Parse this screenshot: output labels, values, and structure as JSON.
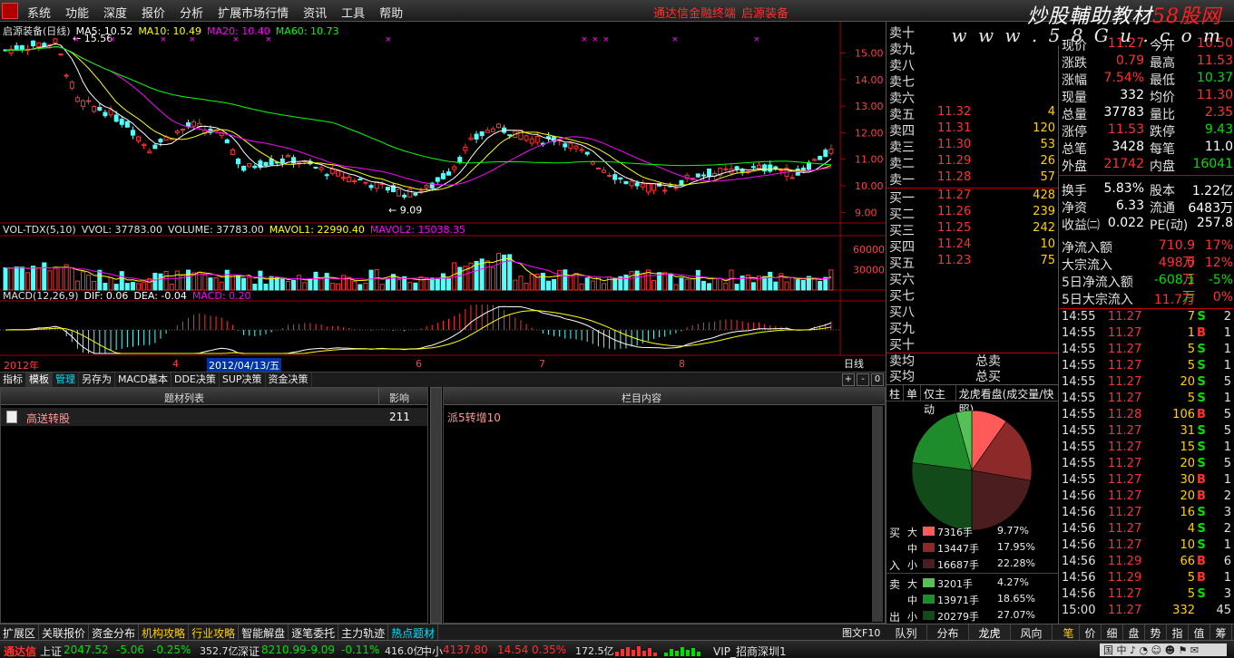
{
  "menubar": {
    "items": [
      "系统",
      "功能",
      "深度",
      "报价",
      "分析",
      "扩展市场行情",
      "资讯",
      "工具",
      "帮助"
    ],
    "center_link_1": "通达信金融终端",
    "center_link_2": "启源装备",
    "brand_main": "炒股輔助教材",
    "brand_domain": "58股网",
    "brand_url": "w w w . 5 8 G u . c o m"
  },
  "chart": {
    "legend_main": {
      "title": "启源装备(日线)",
      "ma5": "MA5: 10.52",
      "ma10": "MA10: 10.49",
      "ma20": "MA20: 10.40",
      "ma60": "MA60: 10.73"
    },
    "legend_vol": {
      "name": "VOL-TDX(5,10)",
      "vvol": "VVOL: 37783.00",
      "volume": "VOLUME: 37783.00",
      "mavol1": "MAVOL1: 22990.40",
      "mavol2": "MAVOL2: 15038.35"
    },
    "legend_macd": {
      "name": "MACD(12,26,9)",
      "dif": "DIF: 0.06",
      "dea": "DEA: -0.04",
      "macd": "MACD: 0.20"
    },
    "price_ticks": [
      "15.00",
      "14.00",
      "13.00",
      "12.00",
      "11.00",
      "10.00",
      "9.00"
    ],
    "vol_ticks": [
      "60000",
      "30000"
    ],
    "high_mark": "15.56",
    "low_mark": "9.09",
    "date_axis": [
      "2012年",
      "4",
      "2012/04/13/五",
      "6",
      "7",
      "8"
    ],
    "period": "日线",
    "colors": {
      "up": "#ff3232",
      "down": "#54fcfc",
      "ma5": "#ffffff",
      "ma10": "#ffff00",
      "ma20": "#ff00ff",
      "ma60": "#00ff00"
    }
  },
  "indicator_tabs": [
    "指标",
    "模板",
    "管理",
    "另存为",
    "MACD基本",
    "DDE决策",
    "SUP决策",
    "资金决策"
  ],
  "indicator_ctl": {
    "plus": "+",
    "minus": "-",
    "zero": "0"
  },
  "topic_pane": {
    "col_list": "题材列表",
    "col_impact": "影响",
    "rows": [
      {
        "name": "高送转股",
        "impact": "211"
      }
    ]
  },
  "content_pane": {
    "title": "栏目内容",
    "text": "派5转增10"
  },
  "orderbook": {
    "sell": [
      {
        "label": "卖十",
        "price": "",
        "vol": ""
      },
      {
        "label": "卖九",
        "price": "",
        "vol": ""
      },
      {
        "label": "卖八",
        "price": "",
        "vol": ""
      },
      {
        "label": "卖七",
        "price": "",
        "vol": ""
      },
      {
        "label": "卖六",
        "price": "",
        "vol": ""
      },
      {
        "label": "卖五",
        "price": "11.32",
        "vol": "4"
      },
      {
        "label": "卖四",
        "price": "11.31",
        "vol": "120"
      },
      {
        "label": "卖三",
        "price": "11.30",
        "vol": "53"
      },
      {
        "label": "卖二",
        "price": "11.29",
        "vol": "26"
      },
      {
        "label": "卖一",
        "price": "11.28",
        "vol": "57"
      }
    ],
    "buy": [
      {
        "label": "买一",
        "price": "11.27",
        "vol": "428"
      },
      {
        "label": "买二",
        "price": "11.26",
        "vol": "239"
      },
      {
        "label": "买三",
        "price": "11.25",
        "vol": "242"
      },
      {
        "label": "买四",
        "price": "11.24",
        "vol": "10"
      },
      {
        "label": "买五",
        "price": "11.23",
        "vol": "75"
      },
      {
        "label": "买六",
        "price": "",
        "vol": ""
      },
      {
        "label": "买七",
        "price": "",
        "vol": ""
      },
      {
        "label": "买八",
        "price": "",
        "vol": ""
      },
      {
        "label": "买九",
        "price": "",
        "vol": ""
      },
      {
        "label": "买十",
        "price": "",
        "vol": ""
      }
    ],
    "avg_sell_label": "卖均",
    "avg_buy_label": "买均",
    "total_sell_label": "总卖",
    "total_buy_label": "总买"
  },
  "quote": {
    "rows": [
      {
        "l1": "现价",
        "v1": "11.27",
        "c1": "red",
        "l2": "今开",
        "v2": "10.50",
        "c2": "red"
      },
      {
        "l1": "涨跌",
        "v1": "0.79",
        "c1": "red",
        "l2": "最高",
        "v2": "11.53",
        "c2": "red"
      },
      {
        "l1": "涨幅",
        "v1": "7.54%",
        "c1": "red",
        "l2": "最低",
        "v2": "10.37",
        "c2": "green"
      },
      {
        "l1": "现量",
        "v1": "332",
        "c1": "white",
        "l2": "均价",
        "v2": "11.30",
        "c2": "red"
      },
      {
        "l1": "总量",
        "v1": "37783",
        "c1": "white",
        "l2": "量比",
        "v2": "2.35",
        "c2": "red"
      },
      {
        "l1": "涨停",
        "v1": "11.53",
        "c1": "red",
        "l2": "跌停",
        "v2": "9.43",
        "c2": "green"
      },
      {
        "l1": "总笔",
        "v1": "3428",
        "c1": "white",
        "l2": "每笔",
        "v2": "11.0",
        "c2": "white"
      },
      {
        "l1": "外盘",
        "v1": "21742",
        "c1": "red",
        "l2": "内盘",
        "v2": "16041",
        "c2": "green"
      },
      {
        "l1": "换手",
        "v1": "5.83%",
        "c1": "white",
        "l2": "股本",
        "v2": "1.22亿",
        "c2": "white"
      },
      {
        "l1": "净资",
        "v1": "6.33",
        "c1": "white",
        "l2": "流通",
        "v2": "6483万",
        "c2": "white"
      },
      {
        "l1": "收益㈡",
        "v1": "0.022",
        "c1": "white",
        "l2": "PE(动)",
        "v2": "257.8",
        "c2": "white"
      }
    ],
    "flows": [
      {
        "label": "净流入额",
        "value": "710.9万",
        "vc": "red",
        "pct": "17%",
        "pc": "red"
      },
      {
        "label": "大宗流入",
        "value": "498.0万",
        "vc": "red",
        "pct": "12%",
        "pc": "red"
      },
      {
        "label": "5日净流入额",
        "value": "-608.1万",
        "vc": "green",
        "pct": "-5%",
        "pc": "green"
      },
      {
        "label": "5日大宗流入",
        "value": "11.7万",
        "vc": "red",
        "pct": "0%",
        "pc": "red"
      }
    ]
  },
  "pie_pane": {
    "tabs": [
      "柱",
      "单",
      "仅主动",
      "龙虎看盘(成交量/快照)"
    ],
    "side_buy_1": "买",
    "side_buy_2": "入",
    "side_sell_1": "卖",
    "side_sell_2": "出",
    "buy": [
      {
        "size": "大",
        "hands": "7316手",
        "pct": "9.77%",
        "color": "#ff5a5a",
        "share": 9.77
      },
      {
        "size": "中",
        "hands": "13447手",
        "pct": "17.95%",
        "color": "#8c2a2a",
        "share": 17.95
      },
      {
        "size": "小",
        "hands": "16687手",
        "pct": "22.28%",
        "color": "#4a1e1e",
        "share": 22.28
      }
    ],
    "sell": [
      {
        "size": "大",
        "hands": "3201手",
        "pct": "4.27%",
        "color": "#55c055",
        "share": 4.27
      },
      {
        "size": "中",
        "hands": "13971手",
        "pct": "18.65%",
        "color": "#1e8c2a",
        "share": 18.65
      },
      {
        "size": "小",
        "hands": "20279手",
        "pct": "27.07%",
        "color": "#124a1a",
        "share": 27.07
      }
    ]
  },
  "ticks": [
    {
      "time": "14:55",
      "price": "11.27",
      "vol": "7",
      "bs": "S",
      "cnt": "2"
    },
    {
      "time": "14:55",
      "price": "11.27",
      "vol": "1",
      "bs": "B",
      "cnt": "1"
    },
    {
      "time": "14:55",
      "price": "11.27",
      "vol": "5",
      "bs": "S",
      "cnt": "1"
    },
    {
      "time": "14:55",
      "price": "11.27",
      "vol": "5",
      "bs": "S",
      "cnt": "1"
    },
    {
      "time": "14:55",
      "price": "11.27",
      "vol": "20",
      "bs": "S",
      "cnt": "5"
    },
    {
      "time": "14:55",
      "price": "11.27",
      "vol": "5",
      "bs": "S",
      "cnt": "1"
    },
    {
      "time": "14:55",
      "price": "11.28",
      "vol": "106",
      "bs": "B",
      "cnt": "5"
    },
    {
      "time": "14:55",
      "price": "11.27",
      "vol": "31",
      "bs": "S",
      "cnt": "5"
    },
    {
      "time": "14:55",
      "price": "11.27",
      "vol": "15",
      "bs": "S",
      "cnt": "1"
    },
    {
      "time": "14:55",
      "price": "11.27",
      "vol": "20",
      "bs": "S",
      "cnt": "5"
    },
    {
      "time": "14:55",
      "price": "11.27",
      "vol": "30",
      "bs": "B",
      "cnt": "1"
    },
    {
      "time": "14:56",
      "price": "11.27",
      "vol": "20",
      "bs": "B",
      "cnt": "2"
    },
    {
      "time": "14:56",
      "price": "11.27",
      "vol": "16",
      "bs": "S",
      "cnt": "3"
    },
    {
      "time": "14:56",
      "price": "11.27",
      "vol": "4",
      "bs": "S",
      "cnt": "2"
    },
    {
      "time": "14:56",
      "price": "11.27",
      "vol": "10",
      "bs": "S",
      "cnt": "1"
    },
    {
      "time": "14:56",
      "price": "11.29",
      "vol": "66",
      "bs": "B",
      "cnt": "6"
    },
    {
      "time": "14:56",
      "price": "11.29",
      "vol": "5",
      "bs": "B",
      "cnt": "1"
    },
    {
      "time": "14:56",
      "price": "11.27",
      "vol": "5",
      "bs": "S",
      "cnt": "3"
    },
    {
      "time": "15:00",
      "price": "11.27",
      "vol": "332",
      "bs": "",
      "cnt": "45"
    }
  ],
  "bottom_tabs": {
    "left": [
      "扩展区",
      "关联报价",
      "资金分布",
      "机构攻略",
      "行业攻略",
      "智能解盘",
      "逐笔委托",
      "主力轨迹",
      "热点题材"
    ],
    "picture": "图文F10",
    "mid": [
      "队列",
      "分布",
      "龙虎",
      "风向"
    ],
    "right": [
      "笔",
      "价",
      "细",
      "盘",
      "势",
      "指",
      "值",
      "筹"
    ]
  },
  "status": {
    "app": "通达信",
    "sh_label": "上证",
    "sh_val": "2047.52",
    "sh_chg": "-5.06",
    "sh_pct": "-0.25%",
    "sh_amt": "352.7亿",
    "sz_label": "深证",
    "sz_val": "8210.99",
    "sz_chg": "-9.09",
    "sz_pct": "-0.11%",
    "sz_amt": "416.0亿",
    "zx_label": "中小",
    "zx_val": "4137.80",
    "zx_chg": "14.54",
    "zx_pct": "0.35%",
    "zx_amt": "172.5亿",
    "server": "VIP_招商深圳1"
  }
}
